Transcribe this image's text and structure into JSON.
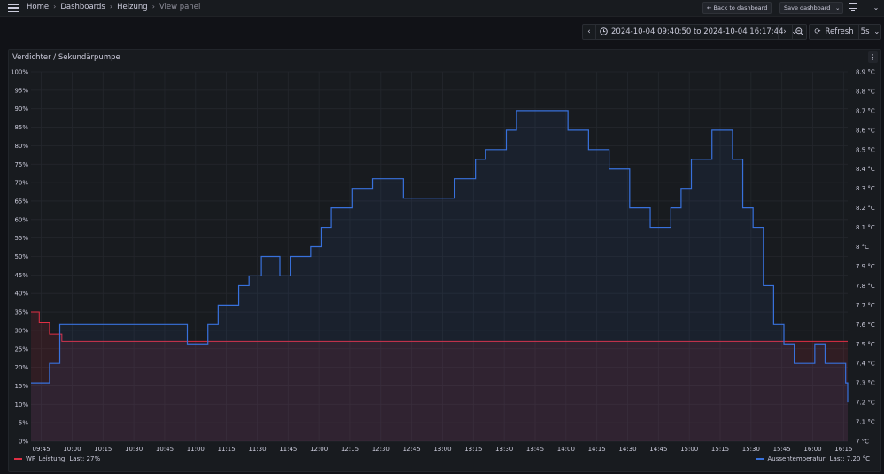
{
  "topbar": {
    "breadcrumbs": [
      "Home",
      "Dashboards",
      "Heizung",
      "View panel"
    ],
    "back_label": "Back to dashboard",
    "back_icon": "arrow-left-icon",
    "save_label": "Save dashboard"
  },
  "timepicker": {
    "range_label": "2024-10-04 09:40:50 to 2024-10-04 16:17:44",
    "refresh_label": "Refresh",
    "interval": "5s"
  },
  "panel": {
    "title": "Verdichter / Sekundärpumpe"
  },
  "colors": {
    "background": "#111217",
    "panel": "#181b1f",
    "wp_series": "#e02f44",
    "aussen_series": "#3871dc",
    "grid": "#24272d"
  },
  "chart_data": {
    "type": "line",
    "interpolation": "step-after",
    "x_tick_labels": [
      "09:45",
      "10:00",
      "10:15",
      "10:30",
      "10:45",
      "11:00",
      "11:15",
      "11:30",
      "11:45",
      "12:00",
      "12:15",
      "12:30",
      "12:45",
      "13:00",
      "13:15",
      "13:30",
      "13:45",
      "14:00",
      "14:15",
      "14:30",
      "14:45",
      "15:00",
      "15:15",
      "15:30",
      "15:45",
      "16:00",
      "16:15"
    ],
    "x_range_minutes_since_0940": [
      0,
      397
    ],
    "y_left": {
      "ylim": [
        0,
        100
      ],
      "unit": "%",
      "ticks": [
        "0%",
        "5%",
        "10%",
        "15%",
        "20%",
        "25%",
        "30%",
        "35%",
        "40%",
        "45%",
        "50%",
        "55%",
        "60%",
        "65%",
        "70%",
        "75%",
        "80%",
        "85%",
        "90%",
        "95%",
        "100%"
      ]
    },
    "y_right": {
      "ylim": [
        7.0,
        8.9
      ],
      "unit": "°C",
      "ticks": [
        "7 °C",
        "7.1 °C",
        "7.2 °C",
        "7.3 °C",
        "7.4 °C",
        "7.5 °C",
        "7.6 °C",
        "7.7 °C",
        "7.8 °C",
        "7.9 °C",
        "8 °C",
        "8.1 °C",
        "8.2 °C",
        "8.3 °C",
        "8.4 °C",
        "8.5 °C",
        "8.6 °C",
        "8.7 °C",
        "8.8 °C",
        "8.9 °C"
      ]
    },
    "grid": true,
    "legend_placement": "bottom",
    "series": [
      {
        "name": "WP_Leistung",
        "axis": "left",
        "last_label": "Last: 27%",
        "points": [
          [
            0,
            35
          ],
          [
            4,
            32
          ],
          [
            9,
            29
          ],
          [
            15,
            27
          ],
          [
            397,
            27
          ]
        ]
      },
      {
        "name": "Aussentemperatur",
        "axis": "right",
        "last_label": "Last: 7.20 °C",
        "points": [
          [
            0,
            7.3
          ],
          [
            9,
            7.4
          ],
          [
            14,
            7.6
          ],
          [
            76,
            7.5
          ],
          [
            86,
            7.6
          ],
          [
            91,
            7.7
          ],
          [
            101,
            7.8
          ],
          [
            106,
            7.85
          ],
          [
            112,
            7.95
          ],
          [
            121,
            7.85
          ],
          [
            126,
            7.95
          ],
          [
            136,
            8.0
          ],
          [
            141,
            8.1
          ],
          [
            146,
            8.2
          ],
          [
            156,
            8.3
          ],
          [
            166,
            8.35
          ],
          [
            181,
            8.25
          ],
          [
            206,
            8.35
          ],
          [
            216,
            8.45
          ],
          [
            221,
            8.5
          ],
          [
            231,
            8.6
          ],
          [
            236,
            8.7
          ],
          [
            261,
            8.6
          ],
          [
            271,
            8.5
          ],
          [
            281,
            8.4
          ],
          [
            291,
            8.2
          ],
          [
            301,
            8.1
          ],
          [
            311,
            8.2
          ],
          [
            316,
            8.3
          ],
          [
            321,
            8.45
          ],
          [
            331,
            8.6
          ],
          [
            341,
            8.45
          ],
          [
            346,
            8.2
          ],
          [
            351,
            8.1
          ],
          [
            356,
            7.8
          ],
          [
            361,
            7.6
          ],
          [
            366,
            7.5
          ],
          [
            371,
            7.4
          ],
          [
            381,
            7.5
          ],
          [
            386,
            7.4
          ],
          [
            396,
            7.3
          ],
          [
            401,
            7.2
          ],
          [
            410,
            7.2
          ]
        ]
      }
    ]
  }
}
